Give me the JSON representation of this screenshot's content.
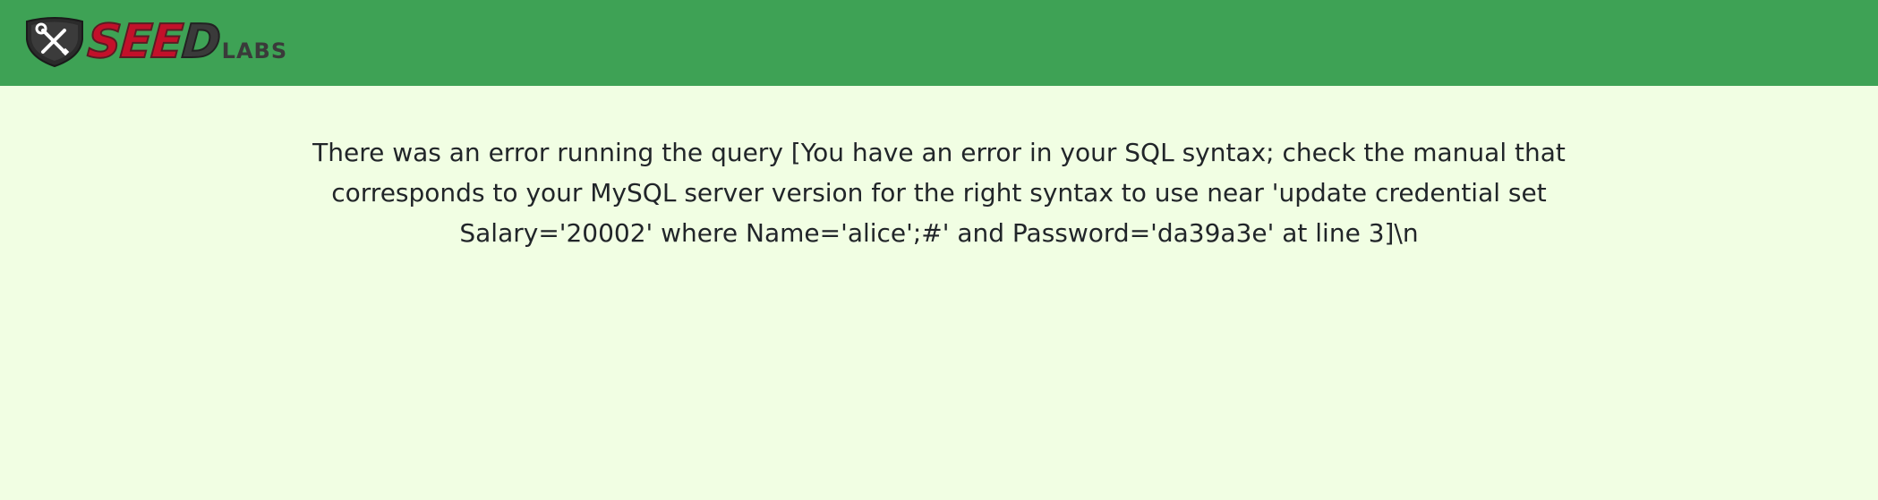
{
  "header": {
    "logo": {
      "icon": "shield-wrench-screwdriver-icon",
      "text_main_red": "SEE",
      "text_main_dark": "D",
      "text_small": "LABS"
    },
    "background_color": "#3ea255"
  },
  "main": {
    "background_color": "#f1fee3",
    "error_message": "There was an error running the query [You have an error in your SQL syntax; check the manual that corresponds to your MySQL server version for the right syntax to use near 'update credential set Salary='20002' where Name='alice';#' and Password='da39a3e' at line 3]\\n"
  }
}
